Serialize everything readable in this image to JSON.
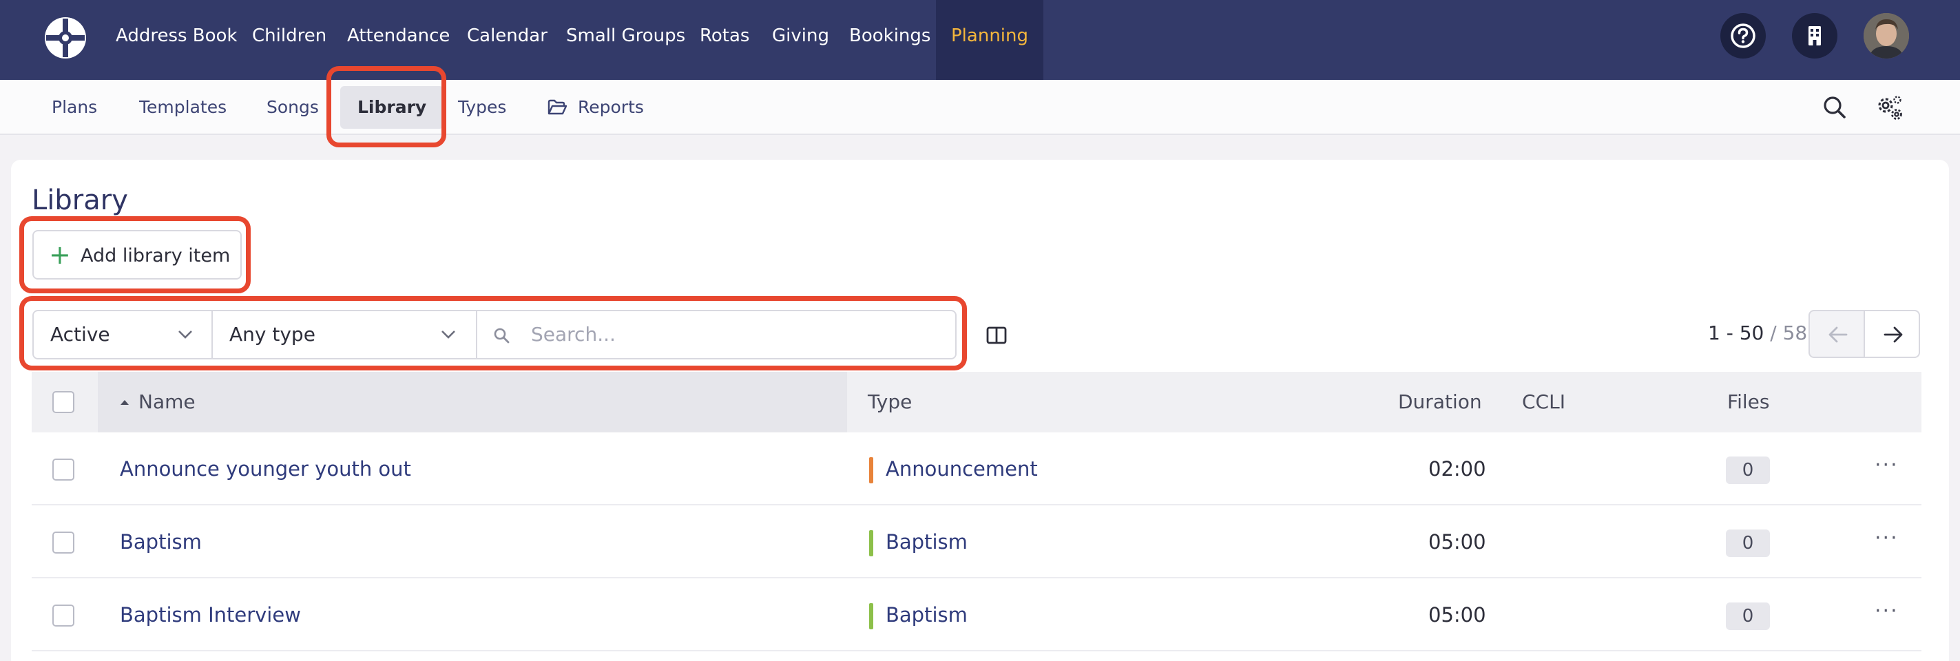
{
  "colors": {
    "topbar": "#333a69",
    "active_nav": "#f4b63c",
    "highlight": "#e8472f",
    "link": "#2f3b7c",
    "announcement": "#e8833a",
    "baptism": "#8dc04a",
    "plus": "#3aa05a"
  },
  "topnav": {
    "logo_icon": "cross-circle-logo",
    "items": [
      {
        "label": "Address Book"
      },
      {
        "label": "Children"
      },
      {
        "label": "Attendance"
      },
      {
        "label": "Calendar"
      },
      {
        "label": "Small Groups"
      },
      {
        "label": "Rotas"
      },
      {
        "label": "Giving"
      },
      {
        "label": "Bookings"
      },
      {
        "label": "Planning",
        "active": true
      }
    ],
    "right_icons": [
      "help-icon",
      "building-icon",
      "avatar"
    ]
  },
  "subnav": {
    "items": [
      {
        "label": "Plans"
      },
      {
        "label": "Templates"
      },
      {
        "label": "Songs"
      },
      {
        "label": "Library",
        "active": true
      },
      {
        "label": "Types"
      },
      {
        "label": "Reports",
        "icon": "folder-open-icon"
      }
    ],
    "right_icons": [
      "search-icon",
      "settings-gears-icon"
    ]
  },
  "main": {
    "title": "Library",
    "add_button_label": "Add library item",
    "filters": {
      "status_value": "Active",
      "type_value": "Any type",
      "search_placeholder": "Search..."
    },
    "pagination": {
      "range": "1 - 50",
      "total": "/ 58"
    },
    "table": {
      "headers": [
        "Name",
        "Type",
        "Duration",
        "CCLI",
        "Files"
      ],
      "sort_column": "Name",
      "rows": [
        {
          "name": "Announce younger youth out",
          "type": "Announcement",
          "type_color": "#e8833a",
          "duration": "02:00",
          "ccli": "",
          "files": "0"
        },
        {
          "name": "Baptism",
          "type": "Baptism",
          "type_color": "#8dc04a",
          "duration": "05:00",
          "ccli": "",
          "files": "0"
        },
        {
          "name": "Baptism Interview",
          "type": "Baptism",
          "type_color": "#8dc04a",
          "duration": "05:00",
          "ccli": "",
          "files": "0"
        }
      ]
    }
  }
}
